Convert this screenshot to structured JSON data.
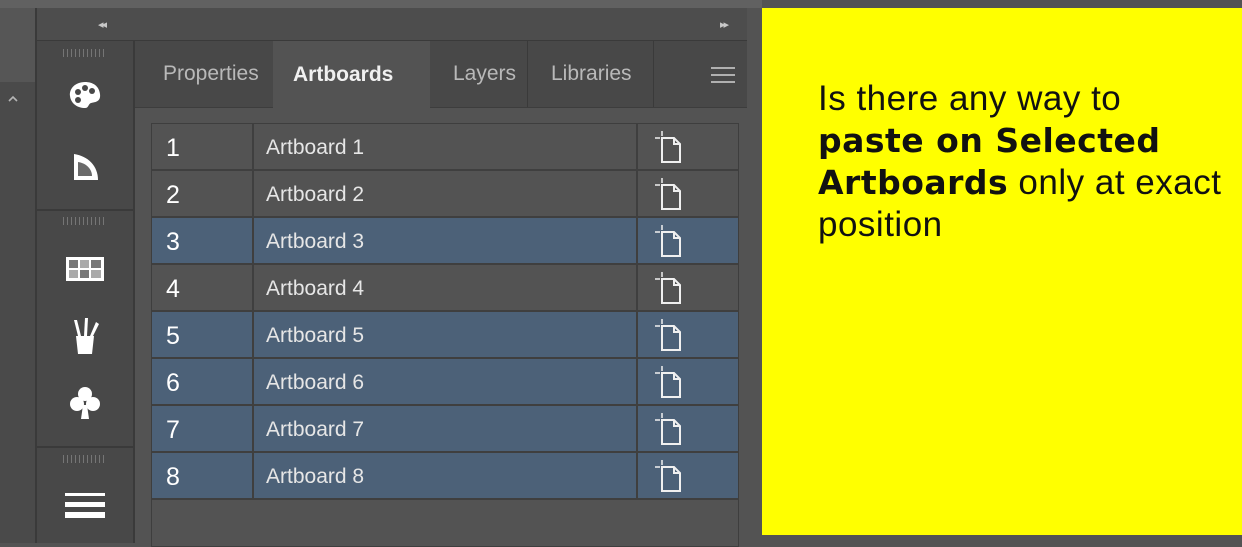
{
  "tabs": [
    {
      "label": "Properties",
      "active": false
    },
    {
      "label": "Artboards",
      "active": true
    },
    {
      "label": "Layers",
      "active": false
    },
    {
      "label": "Libraries",
      "active": false
    }
  ],
  "artboards": [
    {
      "number": "1",
      "name": "Artboard 1",
      "selected": false
    },
    {
      "number": "2",
      "name": "Artboard 2",
      "selected": false
    },
    {
      "number": "3",
      "name": "Artboard 3",
      "selected": true
    },
    {
      "number": "4",
      "name": "Artboard 4",
      "selected": false
    },
    {
      "number": "5",
      "name": "Artboard 5",
      "selected": true
    },
    {
      "number": "6",
      "name": "Artboard 6",
      "selected": true
    },
    {
      "number": "7",
      "name": "Artboard 7",
      "selected": true
    },
    {
      "number": "8",
      "name": "Artboard 8",
      "selected": true
    }
  ],
  "toolstrip": {
    "icons": [
      "color-palette-icon",
      "color-guide-icon",
      "swatches-icon",
      "brushes-icon",
      "symbols-icon",
      "stroke-icon"
    ]
  },
  "callout": {
    "line1": "Is there any way to",
    "bold": "paste on Selected Artboards",
    "rest": " only at exact position"
  },
  "colors": {
    "selected_row": "#4c6178",
    "callout_bg": "#ffff00"
  }
}
